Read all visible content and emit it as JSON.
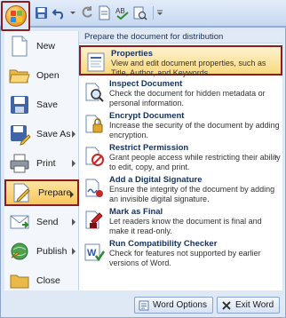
{
  "left_menu": {
    "items": [
      {
        "label": "New",
        "icon": "new-document-icon"
      },
      {
        "label": "Open",
        "icon": "open-folder-icon"
      },
      {
        "label": "Save",
        "icon": "save-icon"
      },
      {
        "label": "Save As",
        "icon": "save-as-icon"
      },
      {
        "label": "Print",
        "icon": "print-icon"
      },
      {
        "label": "Prepare",
        "icon": "prepare-icon"
      },
      {
        "label": "Send",
        "icon": "send-icon"
      },
      {
        "label": "Publish",
        "icon": "publish-icon"
      },
      {
        "label": "Close",
        "icon": "close-folder-icon"
      }
    ]
  },
  "submenu": {
    "heading": "Prepare the document for distribution",
    "items": [
      {
        "title": "Properties",
        "desc": "View and edit document properties, such as Title, Author, and Keywords.",
        "icon": "properties-icon"
      },
      {
        "title": "Inspect Document",
        "desc": "Check the document for hidden metadata or personal information.",
        "icon": "inspect-document-icon"
      },
      {
        "title": "Encrypt Document",
        "desc": "Increase the security of the document by adding encryption.",
        "icon": "encrypt-icon"
      },
      {
        "title": "Restrict Permission",
        "desc": "Grant people access while restricting their ability to edit, copy, and print.",
        "icon": "restrict-permission-icon"
      },
      {
        "title": "Add a Digital Signature",
        "desc": "Ensure the integrity of the document by adding an invisible digital signature.",
        "icon": "digital-signature-icon"
      },
      {
        "title": "Mark as Final",
        "desc": "Let readers know the document is final and make it read-only.",
        "icon": "mark-as-final-icon"
      },
      {
        "title": "Run Compatibility Checker",
        "desc": "Check for features not supported by earlier versions of Word.",
        "icon": "compatibility-checker-icon"
      }
    ]
  },
  "bottom": {
    "options_label": "Word Options",
    "exit_label": "Exit Word"
  },
  "colors": {
    "highlight_border": "#8b1d1d",
    "selection_fill": "#f7c75d",
    "menu_background": "#dfe8f5",
    "heading_text": "#15315f"
  }
}
